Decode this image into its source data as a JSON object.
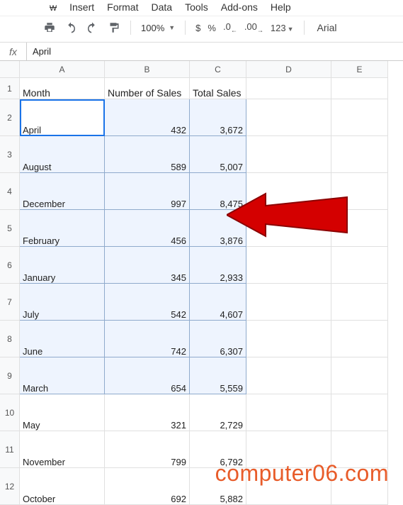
{
  "menu": {
    "items": [
      "w",
      "Insert",
      "Format",
      "Data",
      "Tools",
      "Add-ons",
      "Help"
    ]
  },
  "toolbar": {
    "zoom": "100%",
    "currency": "$",
    "percent": "%",
    "dec_minus": ".0",
    "dec_plus": ".00",
    "format_more": "123",
    "font": "Arial"
  },
  "fx": {
    "label": "fx",
    "value": "April"
  },
  "columns": [
    "A",
    "B",
    "C",
    "D",
    "E"
  ],
  "rows": [
    "1",
    "2",
    "3",
    "4",
    "5",
    "6",
    "7",
    "8",
    "9",
    "10",
    "11",
    "12"
  ],
  "headers": {
    "a": "Month",
    "b": "Number of Sales",
    "c": "Total Sales"
  },
  "data": [
    {
      "month": "April",
      "num": "432",
      "total": "3,672"
    },
    {
      "month": "August",
      "num": "589",
      "total": "5,007"
    },
    {
      "month": "December",
      "num": "997",
      "total": "8,475"
    },
    {
      "month": "February",
      "num": "456",
      "total": "3,876"
    },
    {
      "month": "January",
      "num": "345",
      "total": "2,933"
    },
    {
      "month": "July",
      "num": "542",
      "total": "4,607"
    },
    {
      "month": "June",
      "num": "742",
      "total": "6,307"
    },
    {
      "month": "March",
      "num": "654",
      "total": "5,559"
    },
    {
      "month": "May",
      "num": "321",
      "total": "2,729"
    },
    {
      "month": "November",
      "num": "799",
      "total": "6,792"
    },
    {
      "month": "October",
      "num": "692",
      "total": "5,882"
    }
  ],
  "watermark": "computer06.com",
  "chart_data": {
    "type": "table",
    "title": "",
    "columns": [
      "Month",
      "Number of Sales",
      "Total Sales"
    ],
    "rows": [
      [
        "April",
        432,
        3672
      ],
      [
        "August",
        589,
        5007
      ],
      [
        "December",
        997,
        8475
      ],
      [
        "February",
        456,
        3876
      ],
      [
        "January",
        345,
        2933
      ],
      [
        "July",
        542,
        4607
      ],
      [
        "June",
        742,
        6307
      ],
      [
        "March",
        654,
        5559
      ],
      [
        "May",
        321,
        2729
      ],
      [
        "November",
        799,
        6792
      ],
      [
        "October",
        692,
        5882
      ]
    ]
  }
}
